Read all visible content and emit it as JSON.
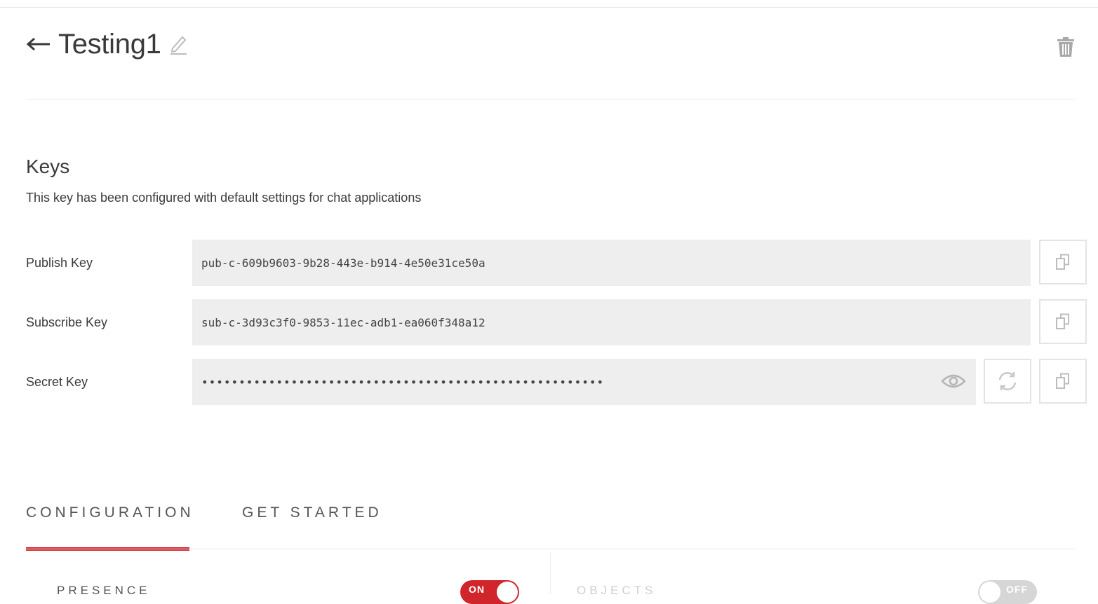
{
  "app": {
    "title": "Testing1"
  },
  "keys_section": {
    "title": "Keys",
    "description": "This key has been configured with default settings for chat applications",
    "publish": {
      "label": "Publish Key",
      "value": "pub-c-609b9603-9b28-443e-b914-4e50e31ce50a"
    },
    "subscribe": {
      "label": "Subscribe Key",
      "value": "sub-c-3d93c3f0-9853-11ec-adb1-ea060f348a12"
    },
    "secret": {
      "label": "Secret Key",
      "value": "••••••••••••••••••••••••••••••••••••••••••••••••••••••"
    }
  },
  "tabs": [
    {
      "label": "CONFIGURATION",
      "active": true
    },
    {
      "label": "GET STARTED",
      "active": false
    }
  ],
  "features": [
    {
      "label": "PRESENCE",
      "toggle_label": "ON",
      "enabled": true
    },
    {
      "label": "OBJECTS",
      "toggle_label": "OFF",
      "enabled": false
    }
  ],
  "colors": {
    "accent": "#d0262b",
    "field_bg": "#eeeeee",
    "icon_gray": "#b5b5b5"
  },
  "icons": {
    "back": "arrow-left-icon",
    "edit": "pencil-icon",
    "delete": "trash-icon",
    "copy": "copy-icon",
    "reveal": "eye-icon",
    "regenerate": "refresh-icon"
  }
}
